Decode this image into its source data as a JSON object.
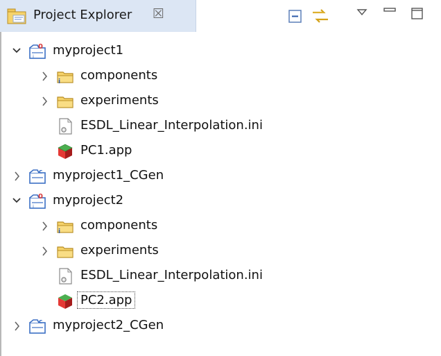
{
  "view": {
    "title": "Project Explorer",
    "close_glyph": "☒",
    "icon": "project-explorer-icon",
    "toolbar": {
      "collapse_all": "collapse-all-icon",
      "link_with_editor": "link-with-editor-icon",
      "view_menu": "view-menu-icon",
      "minimize": "minimize-icon",
      "maximize": "maximize-icon"
    }
  },
  "tree": [
    {
      "label": "myproject1",
      "level": 0,
      "expanded": true,
      "kind": "project"
    },
    {
      "label": "components",
      "level": 1,
      "expanded": false,
      "kind": "components-folder"
    },
    {
      "label": "experiments",
      "level": 1,
      "expanded": false,
      "kind": "folder"
    },
    {
      "label": "ESDL_Linear_Interpolation.ini",
      "level": 1,
      "kind": "ini-file"
    },
    {
      "label": "PC1.app",
      "level": 1,
      "kind": "app-file"
    },
    {
      "label": "myproject1_CGen",
      "level": 0,
      "expanded": false,
      "kind": "cgen-project"
    },
    {
      "label": "myproject2",
      "level": 0,
      "expanded": true,
      "kind": "project"
    },
    {
      "label": "components",
      "level": 1,
      "expanded": false,
      "kind": "components-folder"
    },
    {
      "label": "experiments",
      "level": 1,
      "expanded": false,
      "kind": "folder"
    },
    {
      "label": "ESDL_Linear_Interpolation.ini",
      "level": 1,
      "kind": "ini-file"
    },
    {
      "label": "PC2.app",
      "level": 1,
      "kind": "app-file",
      "focused": true
    },
    {
      "label": "myproject2_CGen",
      "level": 0,
      "expanded": false,
      "kind": "cgen-project"
    }
  ],
  "colors": {
    "tab_background": "#dce6f4",
    "folder_yellow": "#f6d36a",
    "project_blue": "#3b6fc4",
    "project_accent": "#d83b3b"
  }
}
